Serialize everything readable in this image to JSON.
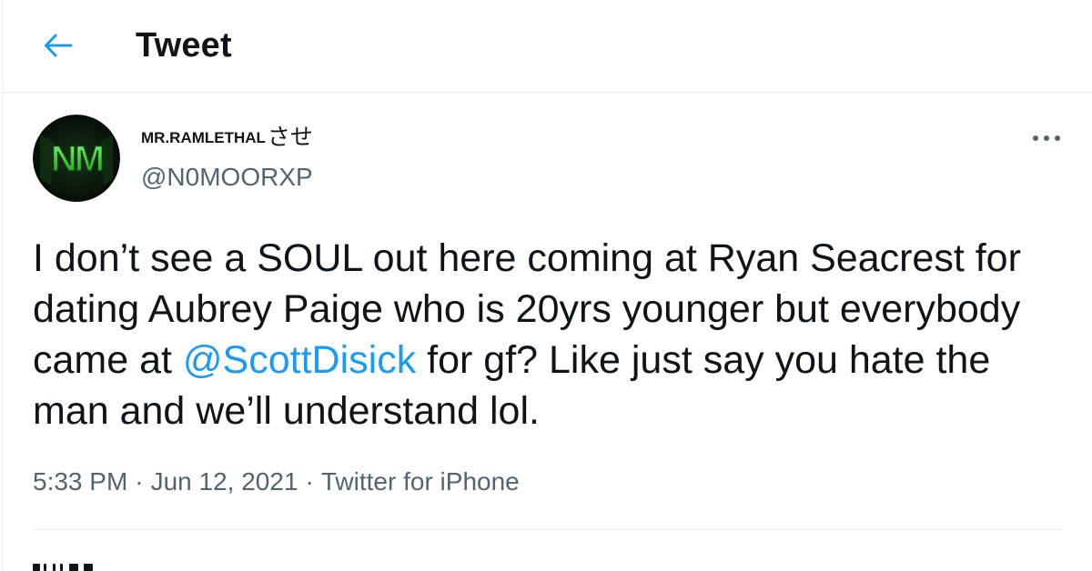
{
  "header": {
    "back_icon": "arrow-left-icon",
    "title": "Tweet"
  },
  "tweet": {
    "author": {
      "display_name": "MR.RAMLETHAL",
      "display_name_suffix": "させ",
      "handle": "@N0MOORXP",
      "avatar_text": "NM"
    },
    "more_icon": "more-horizontal-icon",
    "text_before_mention": "I don’t see a SOUL out here coming at Ryan Seacrest for dating Aubrey Paige who is 20yrs younger but everybody came at ",
    "mention": "@ScottDisick",
    "text_after_mention": " for gf? Like just say you hate the man and we’ll understand lol.",
    "time": "5:33 PM",
    "separator": "·",
    "date": "Jun 12, 2021",
    "source": "Twitter for iPhone"
  },
  "colors": {
    "accent": "#1d9bf0",
    "text_primary": "#0f1419",
    "text_secondary": "#536471",
    "border": "#e6ecf0",
    "avatar_bg": "#0a0f0a",
    "avatar_glyph": "#3fcf3f"
  }
}
